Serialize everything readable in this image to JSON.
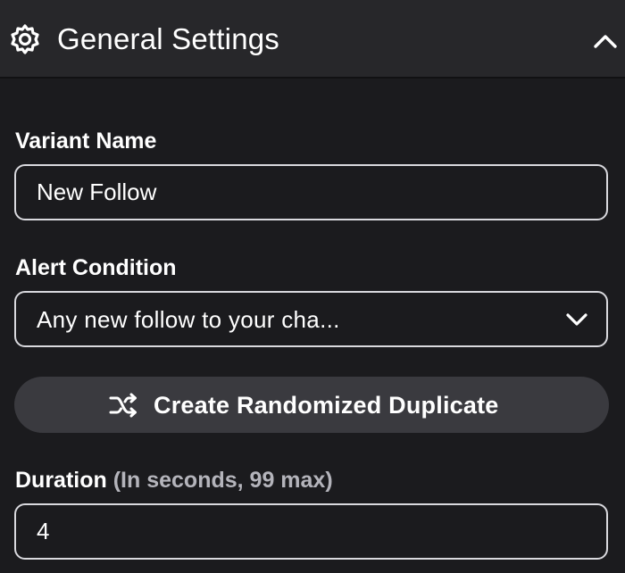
{
  "header": {
    "title": "General Settings",
    "icon": "gear-icon",
    "collapse_icon": "chevron-up-icon"
  },
  "variant_name": {
    "label": "Variant Name",
    "value": "New Follow"
  },
  "alert_condition": {
    "label": "Alert Condition",
    "selected": "Any new follow to your cha...",
    "icon": "chevron-down-icon"
  },
  "duplicate_button": {
    "label": "Create Randomized Duplicate",
    "icon": "shuffle-icon"
  },
  "duration": {
    "label": "Duration",
    "hint": "(In seconds, 99 max)",
    "value": "4"
  },
  "colors": {
    "background": "#1b1b1e",
    "header_background": "#27272a",
    "button_background": "#3a3a3f",
    "field_border": "#d9d9de",
    "hint_text": "#b4b4bb"
  }
}
